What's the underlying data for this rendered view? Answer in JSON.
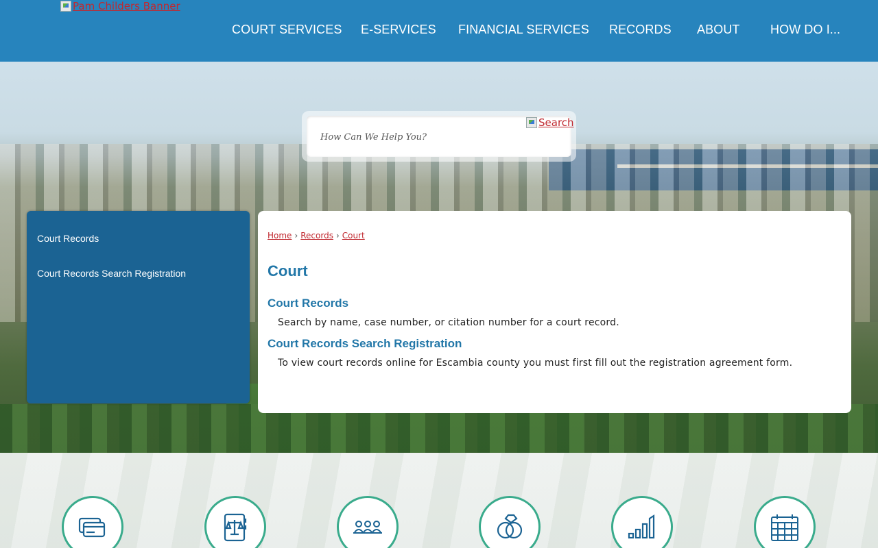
{
  "header": {
    "banner_alt": "Pam Childers Banner",
    "nav": [
      {
        "label": "COURT SERVICES"
      },
      {
        "label": "E-SERVICES"
      },
      {
        "label": "FINANCIAL SERVICES"
      },
      {
        "label": "RECORDS"
      },
      {
        "label": "ABOUT"
      },
      {
        "label": "HOW DO I..."
      }
    ]
  },
  "search": {
    "placeholder": "How Can We Help You?",
    "button_alt": "Search"
  },
  "sidebar": {
    "items": [
      {
        "label": "Court Records"
      },
      {
        "label": "Court Records Search Registration"
      }
    ]
  },
  "breadcrumb": {
    "items": [
      "Home",
      "Records",
      "Court"
    ],
    "separator": "›"
  },
  "main": {
    "title": "Court",
    "sections": [
      {
        "title": "Court Records",
        "description": "Search by name, case number, or citation number for a court record."
      },
      {
        "title": "Court Records Search Registration",
        "description": "To view court records online for Escambia county you must first fill out the registration agreement form."
      }
    ]
  },
  "quick_links": [
    {
      "icon": "credit-card-icon"
    },
    {
      "icon": "scales-book-icon"
    },
    {
      "icon": "jury-icon"
    },
    {
      "icon": "rings-icon"
    },
    {
      "icon": "bar-chart-icon"
    },
    {
      "icon": "calendar-icon"
    }
  ],
  "colors": {
    "header": "#2784bd",
    "sidebar": "#1b6393",
    "link": "#c0282f",
    "heading": "#2277a8",
    "accent": "#3aab8c"
  }
}
